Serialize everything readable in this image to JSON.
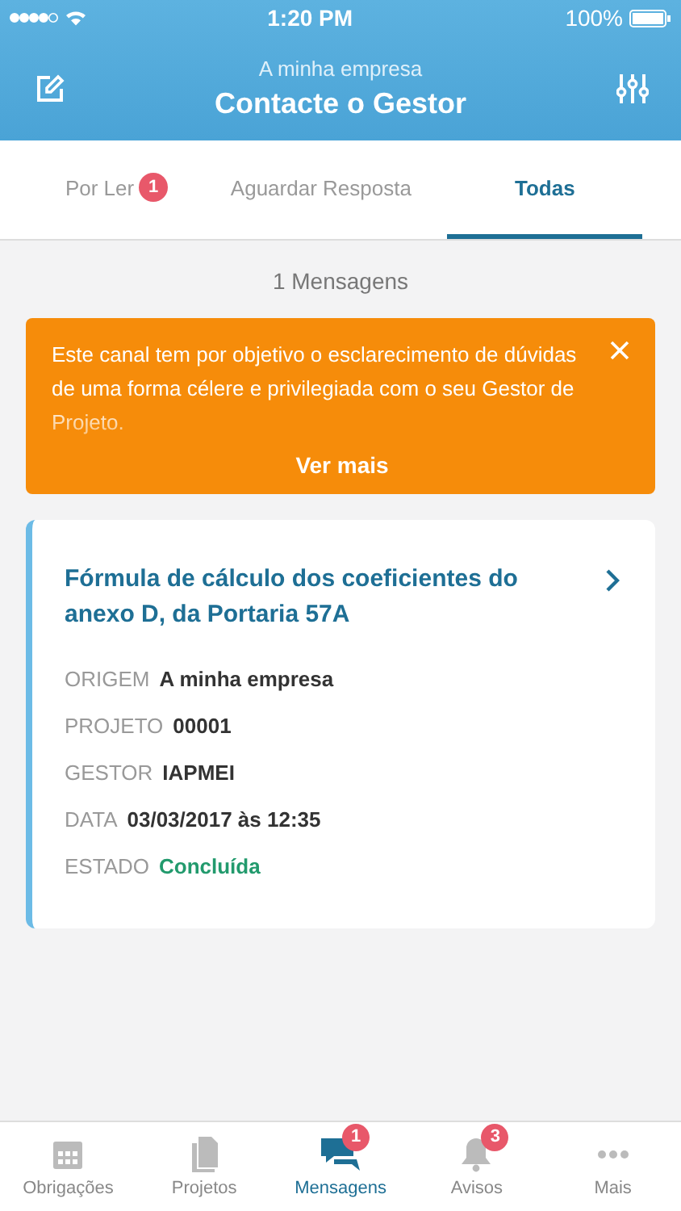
{
  "status_bar": {
    "time": "1:20 PM",
    "battery": "100%"
  },
  "header": {
    "subtitle": "A minha empresa",
    "title": "Contacte o Gestor"
  },
  "tabs": [
    {
      "label": "Por Ler",
      "badge": "1",
      "selected": false
    },
    {
      "label": "Aguardar Resposta",
      "selected": false
    },
    {
      "label": "Todas",
      "selected": true
    }
  ],
  "count": "1 Mensagens",
  "banner": {
    "text": "Este canal tem por objetivo o esclarecimento de dúvidas de uma forma célere e privilegiada com o seu Gestor de Projeto.",
    "more": "Ver mais"
  },
  "messages": [
    {
      "title": "Fórmula de cálculo dos coeficientes do anexo D, da Portaria 57A",
      "fields": [
        {
          "label": "ORIGEM",
          "value": "A minha empresa",
          "kind": "text"
        },
        {
          "label": "PROJETO",
          "value": "00001",
          "kind": "text"
        },
        {
          "label": "GESTOR",
          "value": "IAPMEI",
          "kind": "text"
        },
        {
          "label": "DATA",
          "value": "03/03/2017 às 12:35",
          "kind": "text"
        },
        {
          "label": "ESTADO",
          "value": "Concluída",
          "kind": "status"
        }
      ]
    }
  ],
  "bottom_nav": [
    {
      "label": "Obrigações",
      "kind": "calendar",
      "selected": false
    },
    {
      "label": "Projetos",
      "kind": "document",
      "selected": false
    },
    {
      "label": "Mensagens",
      "kind": "chat",
      "badge": "1",
      "selected": true
    },
    {
      "label": "Avisos",
      "kind": "bell",
      "badge": "3",
      "selected": false
    },
    {
      "label": "Mais",
      "kind": "dots",
      "selected": false
    }
  ]
}
